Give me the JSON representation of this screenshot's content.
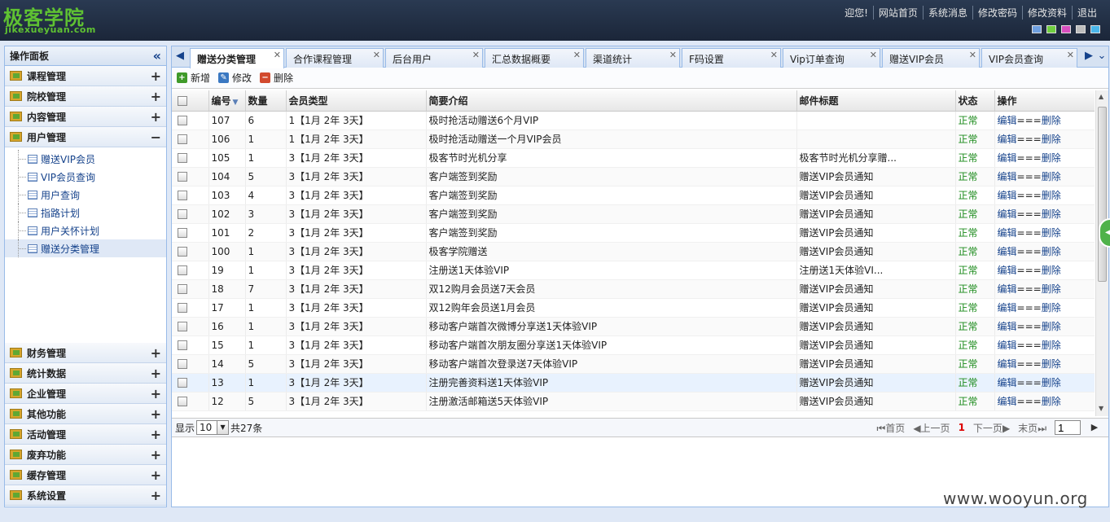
{
  "header": {
    "logo_main": "极客学院",
    "logo_sub": "jikexueyuan.com",
    "nav": [
      "迎您!",
      "网站首页",
      "系统消息",
      "修改密码",
      "修改资料",
      "退出"
    ],
    "skin_colors": [
      "#6fa0e0",
      "#6fce3f",
      "#d84fc0",
      "#bdbdbd",
      "#4ab6ea"
    ]
  },
  "sidebar": {
    "title": "操作面板",
    "top_sections": [
      {
        "label": "课程管理",
        "toggle": "+"
      },
      {
        "label": "院校管理",
        "toggle": "+"
      },
      {
        "label": "内容管理",
        "toggle": "+"
      },
      {
        "label": "用户管理",
        "toggle": "−"
      }
    ],
    "tree_items": [
      "赠送VIP会员",
      "VIP会员查询",
      "用户查询",
      "指路计划",
      "用户关怀计划",
      "赠送分类管理"
    ],
    "bottom_sections": [
      {
        "label": "财务管理",
        "toggle": "+"
      },
      {
        "label": "统计数据",
        "toggle": "+"
      },
      {
        "label": "企业管理",
        "toggle": "+"
      },
      {
        "label": "其他功能",
        "toggle": "+"
      },
      {
        "label": "活动管理",
        "toggle": "+"
      },
      {
        "label": "废弃功能",
        "toggle": "+"
      },
      {
        "label": "缓存管理",
        "toggle": "+"
      },
      {
        "label": "系统设置",
        "toggle": "+"
      }
    ]
  },
  "tabs": [
    "赠送分类管理",
    "合作课程管理",
    "后台用户",
    "汇总数据概要",
    "渠道统计",
    "F码设置",
    "Vip订单查询",
    "赠送VIP会员",
    "VIP会员查询"
  ],
  "toolbar": {
    "add": "新增",
    "edit": "修改",
    "delete": "删除"
  },
  "grid": {
    "columns": [
      "编号",
      "数量",
      "会员类型",
      "简要介绍",
      "邮件标题",
      "状态",
      "操作"
    ],
    "rows": [
      {
        "id": "107",
        "qty": "6",
        "type": "1【1月 2年 3天】",
        "desc": "极时抢活动赠送6个月VIP",
        "mail": "",
        "status": "正常",
        "op_edit": "编辑",
        "op_sep": "===",
        "op_del": "删除"
      },
      {
        "id": "106",
        "qty": "1",
        "type": "1【1月 2年 3天】",
        "desc": "极时抢活动赠送一个月VIP会员",
        "mail": "",
        "status": "正常",
        "op_edit": "编辑",
        "op_sep": "===",
        "op_del": "删除"
      },
      {
        "id": "105",
        "qty": "1",
        "type": "3【1月 2年 3天】",
        "desc": "极客节时光机分享",
        "mail": "极客节时光机分享赠...",
        "status": "正常",
        "op_edit": "编辑",
        "op_sep": "===",
        "op_del": "删除"
      },
      {
        "id": "104",
        "qty": "5",
        "type": "3【1月 2年 3天】",
        "desc": "客户端签到奖励",
        "mail": "赠送VIP会员通知",
        "status": "正常",
        "op_edit": "编辑",
        "op_sep": "===",
        "op_del": "删除"
      },
      {
        "id": "103",
        "qty": "4",
        "type": "3【1月 2年 3天】",
        "desc": "客户端签到奖励",
        "mail": "赠送VIP会员通知",
        "status": "正常",
        "op_edit": "编辑",
        "op_sep": "===",
        "op_del": "删除"
      },
      {
        "id": "102",
        "qty": "3",
        "type": "3【1月 2年 3天】",
        "desc": "客户端签到奖励",
        "mail": "赠送VIP会员通知",
        "status": "正常",
        "op_edit": "编辑",
        "op_sep": "===",
        "op_del": "删除"
      },
      {
        "id": "101",
        "qty": "2",
        "type": "3【1月 2年 3天】",
        "desc": "客户端签到奖励",
        "mail": "赠送VIP会员通知",
        "status": "正常",
        "op_edit": "编辑",
        "op_sep": "===",
        "op_del": "删除"
      },
      {
        "id": "100",
        "qty": "1",
        "type": "3【1月 2年 3天】",
        "desc": "极客学院赠送",
        "mail": "赠送VIP会员通知",
        "status": "正常",
        "op_edit": "编辑",
        "op_sep": "===",
        "op_del": "删除"
      },
      {
        "id": "19",
        "qty": "1",
        "type": "3【1月 2年 3天】",
        "desc": "注册送1天体验VIP",
        "mail": "注册送1天体验VI...",
        "status": "正常",
        "op_edit": "编辑",
        "op_sep": "===",
        "op_del": "删除"
      },
      {
        "id": "18",
        "qty": "7",
        "type": "3【1月 2年 3天】",
        "desc": "双12购月会员送7天会员",
        "mail": "赠送VIP会员通知",
        "status": "正常",
        "op_edit": "编辑",
        "op_sep": "===",
        "op_del": "删除"
      },
      {
        "id": "17",
        "qty": "1",
        "type": "3【1月 2年 3天】",
        "desc": "双12购年会员送1月会员",
        "mail": "赠送VIP会员通知",
        "status": "正常",
        "op_edit": "编辑",
        "op_sep": "===",
        "op_del": "删除"
      },
      {
        "id": "16",
        "qty": "1",
        "type": "3【1月 2年 3天】",
        "desc": "移动客户端首次微博分享送1天体验VIP",
        "mail": "赠送VIP会员通知",
        "status": "正常",
        "op_edit": "编辑",
        "op_sep": "===",
        "op_del": "删除"
      },
      {
        "id": "15",
        "qty": "1",
        "type": "3【1月 2年 3天】",
        "desc": "移动客户端首次朋友圈分享送1天体验VIP",
        "mail": "赠送VIP会员通知",
        "status": "正常",
        "op_edit": "编辑",
        "op_sep": "===",
        "op_del": "删除"
      },
      {
        "id": "14",
        "qty": "5",
        "type": "3【1月 2年 3天】",
        "desc": "移动客户端首次登录送7天体验VIP",
        "mail": "赠送VIP会员通知",
        "status": "正常",
        "op_edit": "编辑",
        "op_sep": "===",
        "op_del": "删除"
      },
      {
        "id": "13",
        "qty": "1",
        "type": "3【1月 2年 3天】",
        "desc": "注册完善资料送1天体验VIP",
        "mail": "赠送VIP会员通知",
        "status": "正常",
        "op_edit": "编辑",
        "op_sep": "===",
        "op_del": "删除"
      },
      {
        "id": "12",
        "qty": "5",
        "type": "3【1月 2年 3天】",
        "desc": "注册激活邮箱送5天体验VIP",
        "mail": "赠送VIP会员通知",
        "status": "正常",
        "op_edit": "编辑",
        "op_sep": "===",
        "op_del": "删除"
      }
    ]
  },
  "pager": {
    "show_label": "显示",
    "page_size": "10",
    "total": "共27条",
    "first": "首页",
    "prev": "上一页",
    "current": "1",
    "next": "下一页",
    "last": "末页",
    "page_input": "1"
  },
  "watermark": "www.wooyun.org"
}
